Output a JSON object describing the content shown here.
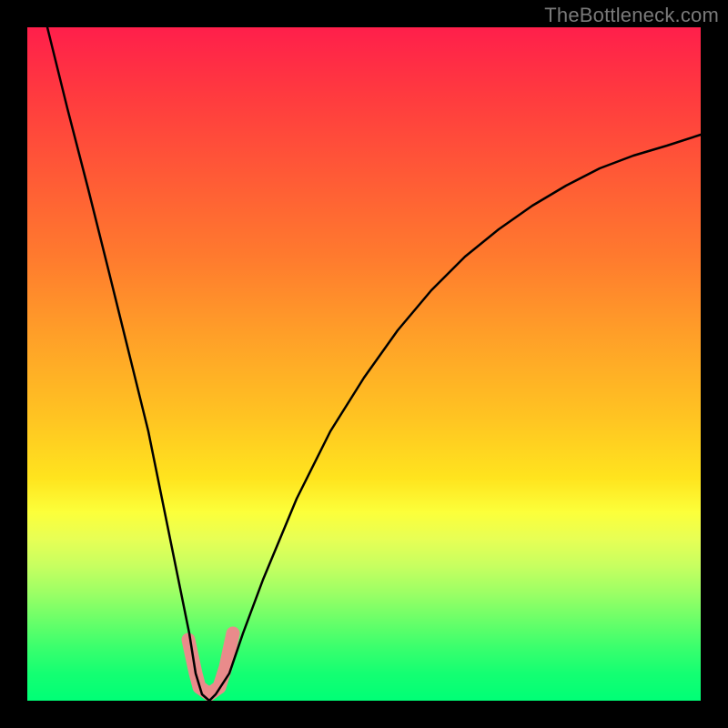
{
  "watermark": "TheBottleneck.com",
  "chart_data": {
    "type": "line",
    "title": "",
    "xlabel": "",
    "ylabel": "",
    "xlim": [
      0,
      100
    ],
    "ylim": [
      0,
      100
    ],
    "grid": false,
    "legend": false,
    "background": "heatmap-gradient-red-to-green",
    "x": [
      3,
      6,
      9,
      12,
      15,
      18,
      20,
      22,
      24,
      25,
      26,
      27,
      28,
      30,
      32,
      35,
      40,
      45,
      50,
      55,
      60,
      65,
      70,
      75,
      80,
      85,
      90,
      95,
      100
    ],
    "y": [
      100,
      88,
      76,
      64,
      52,
      40,
      30,
      20,
      10,
      4,
      1,
      0,
      1,
      4,
      10,
      18,
      30,
      40,
      48,
      55,
      61,
      66,
      70,
      73.5,
      76.5,
      79,
      81,
      82.5,
      84
    ],
    "highlight_segments": [
      {
        "x": [
          24.0,
          25.0,
          25.5
        ],
        "y": [
          9.0,
          4.0,
          2.0
        ]
      },
      {
        "x": [
          25.5,
          27.0,
          28.5
        ],
        "y": [
          2.0,
          1.0,
          2.0
        ]
      },
      {
        "x": [
          28.5,
          29.5,
          30.5
        ],
        "y": [
          2.0,
          5.0,
          10.0
        ]
      }
    ]
  }
}
